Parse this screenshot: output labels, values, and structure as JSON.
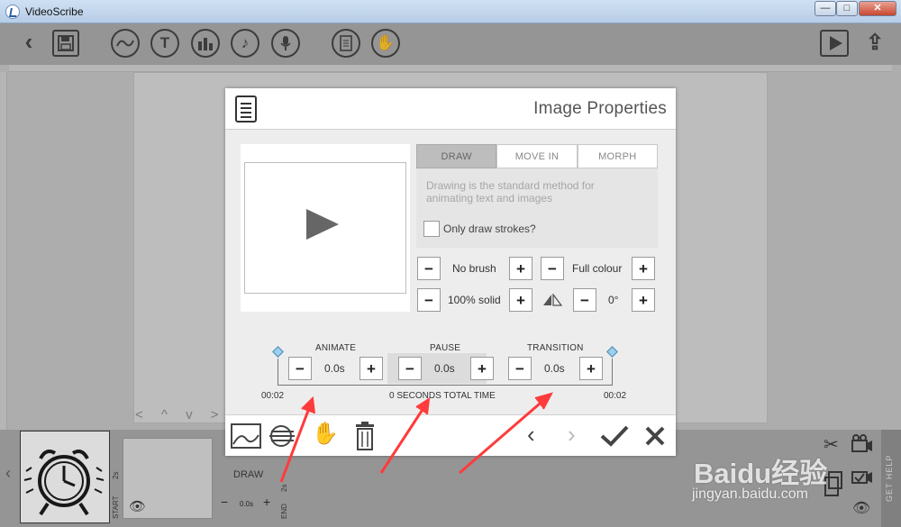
{
  "window": {
    "title": "VideoScribe",
    "minimize": "—",
    "maximize": "□",
    "close": "✕"
  },
  "toolbar": {
    "back": "‹",
    "save": "💾",
    "chart": "〰",
    "text": "T",
    "bars": "▮▮",
    "music": "♪",
    "mic": "🎤",
    "doc": "≡",
    "hand": "✋",
    "play": "▶",
    "export": "⇪"
  },
  "workspace": {
    "nav_arrows": "< ^ v >"
  },
  "dialog": {
    "title": "Image Properties",
    "tabs": [
      "DRAW",
      "MOVE IN",
      "MORPH"
    ],
    "active_tab": "DRAW",
    "description": "Drawing is the standard method for animating text and images",
    "checkbox_label": "Only draw strokes?",
    "brush": "No brush",
    "colour": "Full colour",
    "opacity": "100% solid",
    "rotation": "0°",
    "animate_label": "ANIMATE",
    "pause_label": "PAUSE",
    "transition_label": "TRANSITION",
    "animate_value": "0.0s",
    "pause_value": "0.0s",
    "transition_value": "0.0s",
    "start_time": "00:02",
    "total_time": "0 SECONDS TOTAL TIME",
    "end_time": "00:02"
  },
  "timeline": {
    "draw_label": "DRAW",
    "duration_value": "0.0s",
    "thumb2_time": "2s",
    "start_label": "START",
    "end_label": "END",
    "end_time": "2s",
    "get_help": "GET HELP"
  },
  "watermark": {
    "logo": "Baidu经验",
    "url": "jingyan.baidu.com"
  },
  "icons": [
    "save-icon",
    "chart-icon",
    "text-icon",
    "bars-icon",
    "music-icon",
    "mic-icon",
    "document-icon",
    "hand-icon",
    "play-icon",
    "export-icon",
    "image-icon",
    "morph-icon",
    "trash-icon",
    "check-icon",
    "close-icon",
    "scissors-icon",
    "camera-icon",
    "eye-icon"
  ],
  "colors": {
    "toolbar": "#aaa9a9",
    "dialog_bg": "#ededed",
    "active_tab": "#bdbdbd",
    "annotation_arrow": "#ff3b3b",
    "diamond": "#9ad0ee"
  }
}
